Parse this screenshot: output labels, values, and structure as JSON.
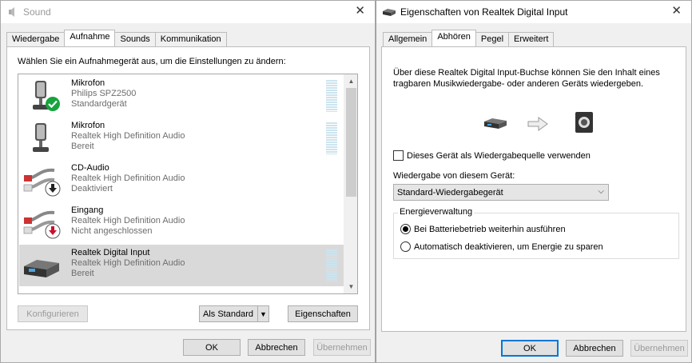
{
  "sound_window": {
    "title": "Sound",
    "tabs": [
      {
        "label": "Wiedergabe"
      },
      {
        "label": "Aufnahme"
      },
      {
        "label": "Sounds"
      },
      {
        "label": "Kommunikation"
      }
    ],
    "instruction": "Wählen Sie ein Aufnahmegerät aus, um die Einstellungen zu ändern:",
    "devices": [
      {
        "name": "Mikrofon",
        "line1": "Philips SPZ2500",
        "line2": "Standardgerät",
        "icon": "microphone-icon",
        "badge": "check-badge-icon"
      },
      {
        "name": "Mikrofon",
        "line1": "Realtek High Definition Audio",
        "line2": "Bereit",
        "icon": "microphone-icon",
        "badge": ""
      },
      {
        "name": "CD-Audio",
        "line1": "Realtek High Definition Audio",
        "line2": "Deaktiviert",
        "icon": "rca-cable-icon",
        "badge": "disabled-arrow-badge-icon"
      },
      {
        "name": "Eingang",
        "line1": "Realtek High Definition Audio",
        "line2": "Nicht angeschlossen",
        "icon": "rca-cable-icon",
        "badge": "unplugged-arrow-badge-icon"
      },
      {
        "name": "Realtek Digital Input",
        "line1": "Realtek High Definition Audio",
        "line2": "Bereit",
        "icon": "digital-input-device-icon",
        "badge": ""
      }
    ],
    "buttons": {
      "configure": "Konfigurieren",
      "set_default": "Als Standard",
      "properties": "Eigenschaften",
      "ok": "OK",
      "cancel": "Abbrechen",
      "apply": "Übernehmen"
    }
  },
  "props_window": {
    "title": "Eigenschaften von Realtek Digital Input",
    "tabs": [
      {
        "label": "Allgemein"
      },
      {
        "label": "Abhören"
      },
      {
        "label": "Pegel"
      },
      {
        "label": "Erweitert"
      }
    ],
    "description": "Über diese Realtek Digital Input-Buchse können Sie den Inhalt eines tragbaren Musikwiedergabe- oder anderen Geräts wiedergeben.",
    "listen_checkbox": "Dieses Gerät als Wiedergabequelle verwenden",
    "playback_label": "Wiedergabe von diesem Gerät:",
    "playback_value": "Standard-Wiedergabegerät",
    "power_group": "Energieverwaltung",
    "power_options": [
      {
        "label": "Bei Batteriebetrieb weiterhin ausführen",
        "checked": true
      },
      {
        "label": "Automatisch deaktivieren, um Energie zu sparen",
        "checked": false
      }
    ],
    "buttons": {
      "ok": "OK",
      "cancel": "Abbrechen",
      "apply": "Übernehmen"
    }
  },
  "colors": {
    "accent": "#0078d7",
    "selection": "#d9d9d9",
    "meter": "#cce4ee",
    "check_badge": "#18a33e",
    "arrow_badge": "#c8102e"
  }
}
